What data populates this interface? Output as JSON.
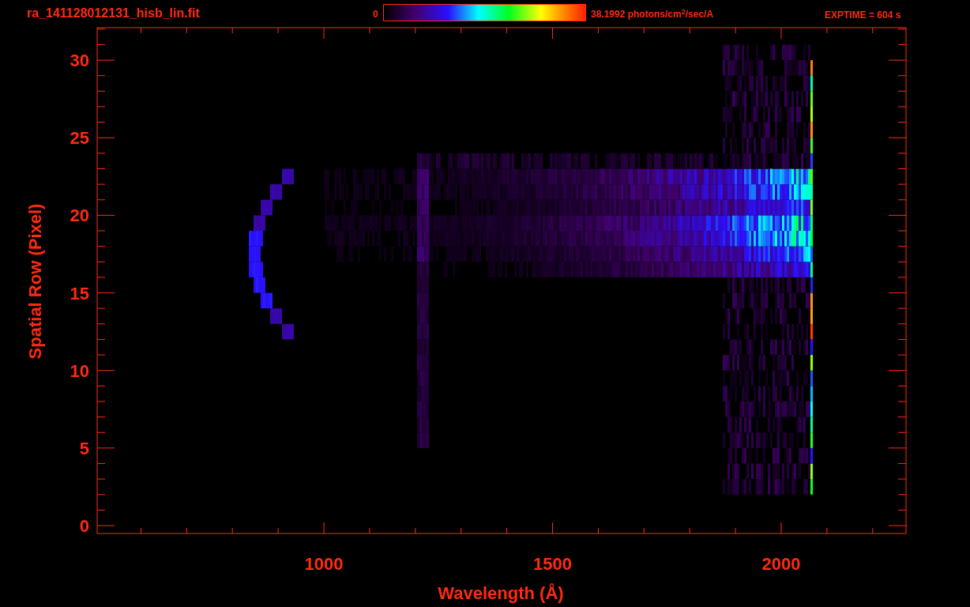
{
  "header": {
    "filename": "ra_141128012131_hisb_lin.fit",
    "colorbar_min": "0",
    "colorbar_max": "38.1992 photons/cm$^{2}$/sec/A",
    "exposure": "EXPTIME = 604 s"
  },
  "plot": {
    "xlabel": "Wavelength (Å)",
    "ylabel": "Spatial Row (Pixel)",
    "xticks": [
      "1000",
      "1500",
      "2000"
    ],
    "yticks": [
      "30",
      "25",
      "20",
      "15",
      "10",
      "5",
      "0"
    ]
  }
}
